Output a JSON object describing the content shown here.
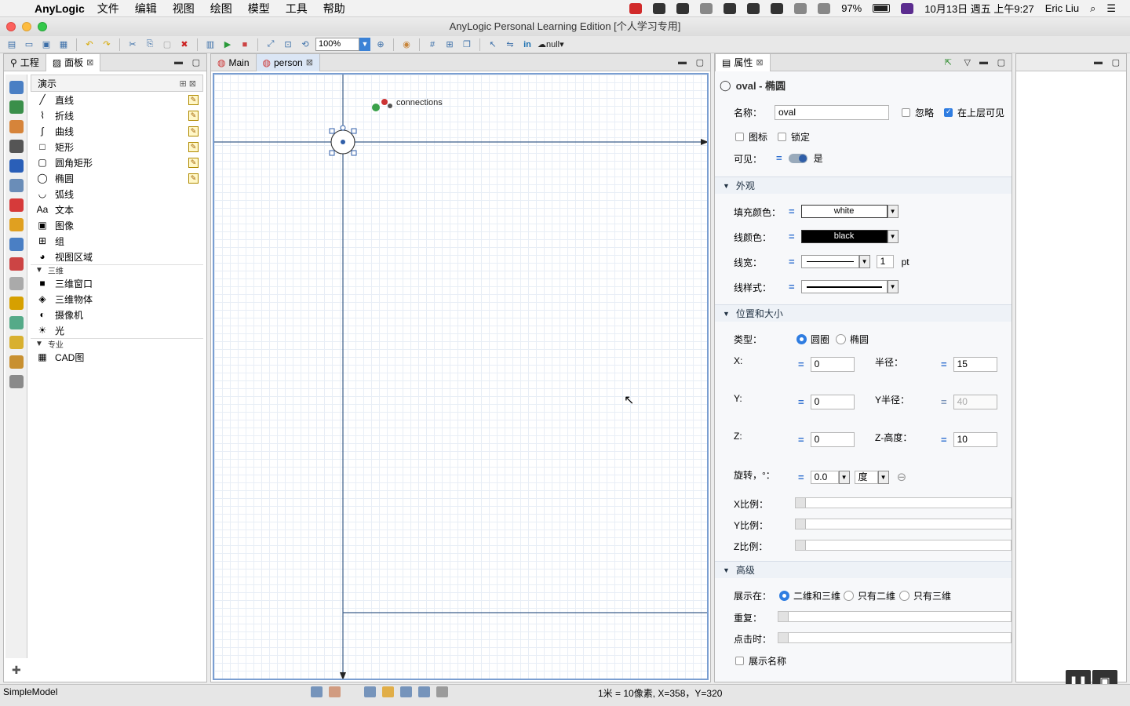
{
  "menubar": {
    "app_name": "AnyLogic",
    "menus": [
      "文件",
      "编辑",
      "视图",
      "绘图",
      "模型",
      "工具",
      "帮助"
    ],
    "battery": "97%",
    "datetime": "10月13日 週五 上午9:27",
    "user": "Eric Liu"
  },
  "window": {
    "title": "AnyLogic Personal Learning Edition [个人学习专用]"
  },
  "toolbar": {
    "zoom": "100%",
    "null_label": "null"
  },
  "left_panel": {
    "tabs": [
      {
        "label": "工程"
      },
      {
        "label": "面板"
      }
    ],
    "palette_title": "演示",
    "items": [
      {
        "label": "直线",
        "icon": "line-icon",
        "glyph": "╱",
        "editable": true
      },
      {
        "label": "折线",
        "icon": "polyline-icon",
        "glyph": "⌇",
        "editable": true
      },
      {
        "label": "曲线",
        "icon": "curve-icon",
        "glyph": "∫",
        "editable": true
      },
      {
        "label": "矩形",
        "icon": "rectangle-icon",
        "glyph": "□",
        "editable": true
      },
      {
        "label": "圆角矩形",
        "icon": "rounded-rectangle-icon",
        "glyph": "▢",
        "editable": true
      },
      {
        "label": "椭圆",
        "icon": "oval-icon",
        "glyph": "◯",
        "editable": true
      },
      {
        "label": "弧线",
        "icon": "arc-icon",
        "glyph": "◡",
        "editable": false
      },
      {
        "label": "文本",
        "icon": "text-icon",
        "glyph": "Aa",
        "editable": false
      },
      {
        "label": "图像",
        "icon": "image-icon",
        "glyph": "▣",
        "editable": false
      },
      {
        "label": "组",
        "icon": "group-icon",
        "glyph": "⊞",
        "editable": false
      },
      {
        "label": "视图区域",
        "icon": "view-area-icon",
        "glyph": "◕",
        "editable": false
      }
    ],
    "section_3d": "三维",
    "items_3d": [
      {
        "label": "三维窗口",
        "icon": "3d-window-icon",
        "glyph": "■"
      },
      {
        "label": "三维物体",
        "icon": "3d-object-icon",
        "glyph": "◈"
      },
      {
        "label": "摄像机",
        "icon": "camera-icon",
        "glyph": "◐"
      },
      {
        "label": "光",
        "icon": "light-icon",
        "glyph": "☀"
      }
    ],
    "section_pro": "专业",
    "items_pro": [
      {
        "label": "CAD图",
        "icon": "cad-icon",
        "glyph": "▦"
      }
    ]
  },
  "editor": {
    "tabs": [
      {
        "label": "Main"
      },
      {
        "label": "person"
      }
    ],
    "connections_label": "connections"
  },
  "properties": {
    "tab": "属性",
    "header": "oval - 椭圆",
    "name_label": "名称：",
    "name_value": "oval",
    "ignore_label": "忽略",
    "upper_visible_label": "在上层可见",
    "icon_label": "图标",
    "lock_label": "锁定",
    "visible_label": "可见：",
    "visible_value": "是",
    "appearance": {
      "title": "外观",
      "fill_label": "填充颜色：",
      "fill_value": "white",
      "line_color_label": "线颜色：",
      "line_color_value": "black",
      "line_width_label": "线宽：",
      "line_width_value": "1",
      "line_width_unit": "pt",
      "line_style_label": "线样式："
    },
    "position": {
      "title": "位置和大小",
      "type_label": "类型：",
      "type_circle": "圆圈",
      "type_oval": "椭圆",
      "x_label": "X:",
      "x_value": "0",
      "radius_label": "半径：",
      "radius_value": "15",
      "y_label": "Y:",
      "y_value": "0",
      "y_radius_label": "Y半径：",
      "y_radius_value": "40",
      "z_label": "Z:",
      "z_value": "0",
      "z_height_label": "Z-高度：",
      "z_height_value": "10",
      "rotation_label": "旋转，°：",
      "rotation_value": "0.0",
      "rotation_unit": "度",
      "x_scale_label": "X比例：",
      "y_scale_label": "Y比例：",
      "z_scale_label": "Z比例："
    },
    "advanced": {
      "title": "高级",
      "show_in_label": "展示在：",
      "opt_2d3d": "二维和三维",
      "opt_2d": "只有二维",
      "opt_3d": "只有三维",
      "repeat_label": "重复：",
      "on_click_label": "点击时：",
      "show_name_label": "展示名称"
    }
  },
  "statusbar": {
    "model": "SimpleModel",
    "scale_info": "1米 = 10像素, X=358，Y=320"
  },
  "colors": {
    "accent": "#2f7de1",
    "canvas_border": "#7a9ed1",
    "axis": "#3c5e8a"
  }
}
